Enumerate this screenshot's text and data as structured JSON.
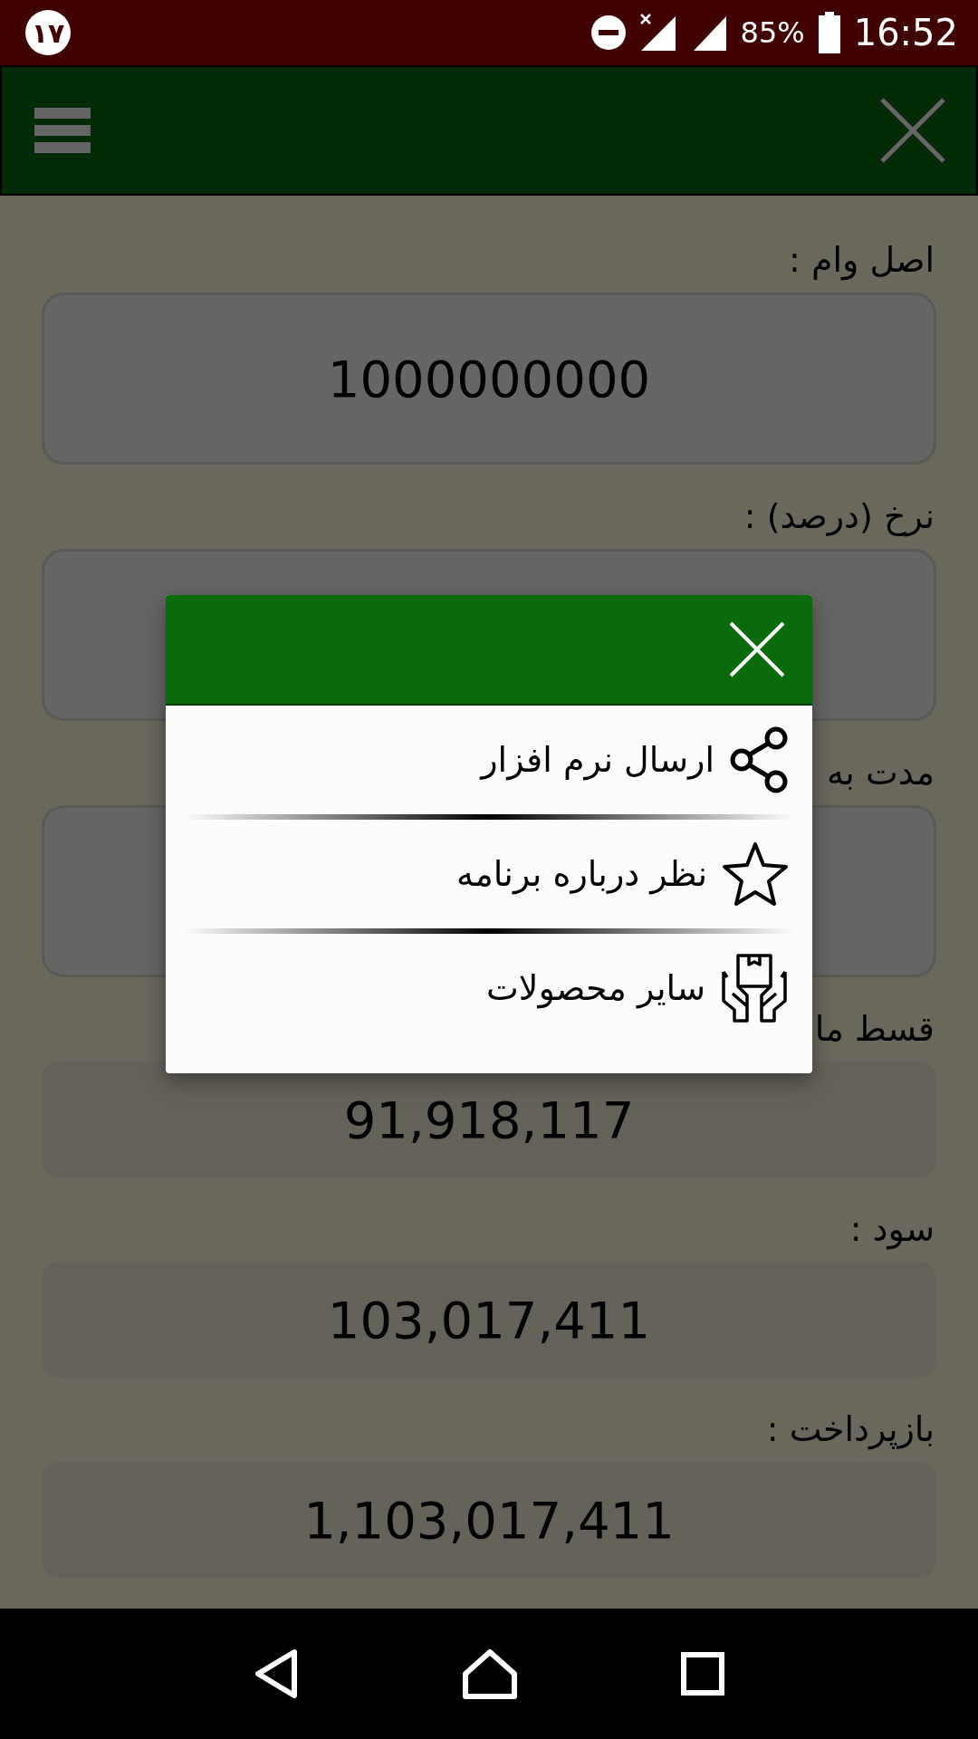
{
  "status_bar": {
    "notification_badge": "۱۷",
    "battery_percent": "85%",
    "time": "16:52"
  },
  "form": {
    "fields": [
      {
        "label": "اصل وام :",
        "kind": "input",
        "value": "1000000000"
      },
      {
        "label": "نرخ (درصد) :",
        "kind": "input"
      },
      {
        "label": "مدت به",
        "kind": "input"
      },
      {
        "label": "قسط ما",
        "kind": "output",
        "value": "91,918,117"
      },
      {
        "label": "سود :",
        "kind": "output",
        "value": "103,017,411"
      },
      {
        "label": "بازپرداخت :",
        "kind": "output",
        "value": "1,103,017,411"
      }
    ]
  },
  "dialog": {
    "items": [
      {
        "kind": "share",
        "label": "ارسال نرم افزار"
      },
      {
        "kind": "star",
        "label": "نظر درباره برنامه"
      },
      {
        "kind": "products",
        "label": "سایر محصولات"
      }
    ]
  }
}
